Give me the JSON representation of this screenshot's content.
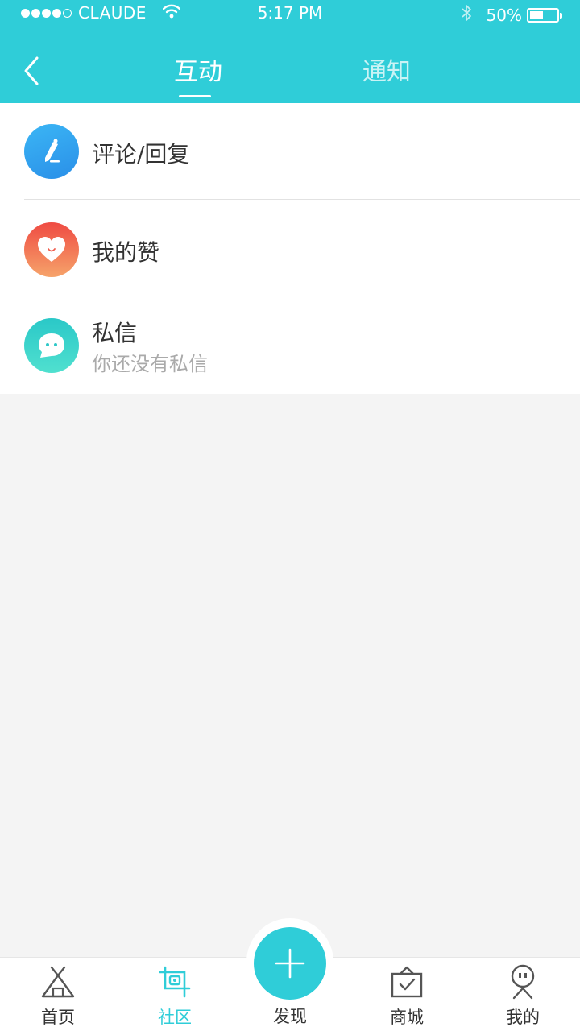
{
  "status_bar": {
    "carrier": "CLAUDE",
    "time": "5:17 PM",
    "battery": "50%",
    "battery_level": 0.5,
    "signal_dots": [
      true,
      true,
      true,
      true,
      false
    ],
    "icons": [
      "wifi-icon",
      "bluetooth-icon",
      "battery-icon"
    ]
  },
  "header": {
    "back_icon": "chevron-left-icon",
    "tabs": [
      {
        "label": "互动",
        "active": true
      },
      {
        "label": "通知",
        "active": false
      }
    ]
  },
  "list": [
    {
      "title": "评论/回复",
      "subtitle": "",
      "icon": "pencil-icon",
      "color": "#2f9ef0"
    },
    {
      "title": "我的赞",
      "subtitle": "",
      "icon": "heart-icon",
      "color": "#f05a4a"
    },
    {
      "title": "私信",
      "subtitle": "你还没有私信",
      "icon": "chat-bubble-icon",
      "color": "#32d0c8"
    }
  ],
  "tabbar": {
    "items": [
      {
        "label": "首页",
        "icon": "tent-icon",
        "active": false
      },
      {
        "label": "社区",
        "icon": "community-icon",
        "active": true
      },
      {
        "label": "发现",
        "icon": "plus-icon",
        "active": false
      },
      {
        "label": "商城",
        "icon": "shop-bag-icon",
        "active": false
      },
      {
        "label": "我的",
        "icon": "user-face-icon",
        "active": false
      }
    ]
  },
  "colors": {
    "accent": "#2fcdd8",
    "background": "#f4f4f4",
    "text": "#333333",
    "subtext": "#aaaaaa"
  }
}
